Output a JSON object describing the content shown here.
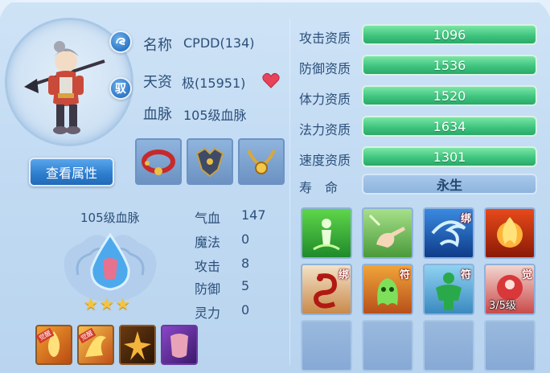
{
  "pet": {
    "name_label": "名称",
    "name_value": "CPDD(134)",
    "talent_label": "天资",
    "talent_value": "极(15951)",
    "blood_label": "血脉",
    "blood_value": "105级血脉",
    "lock_glyph": "驭",
    "view_button": "查看属性"
  },
  "bloodline": {
    "title": "105级血脉",
    "stars": "★★★",
    "stats": [
      {
        "label": "气血",
        "value": "147"
      },
      {
        "label": "魔法",
        "value": "0"
      },
      {
        "label": "攻击",
        "value": "8"
      },
      {
        "label": "防御",
        "value": "5"
      },
      {
        "label": "灵力",
        "value": "0"
      }
    ],
    "small_skill_tag": "觉醒"
  },
  "aptitudes": [
    {
      "label": "攻击资质",
      "value": "1096"
    },
    {
      "label": "防御资质",
      "value": "1536"
    },
    {
      "label": "体力资质",
      "value": "1520"
    },
    {
      "label": "法力资质",
      "value": "1634"
    },
    {
      "label": "速度资质",
      "value": "1301"
    }
  ],
  "lifespan": {
    "label": "寿　命",
    "value": "永生"
  },
  "skills": {
    "badges": {
      "bind": "绑",
      "talisman": "符",
      "awaken": "觉"
    },
    "awaken_level": "3/5级"
  },
  "icons": [
    "dragon-badge-icon",
    "heart-icon",
    "red-collar-icon",
    "armor-icon",
    "gold-necklace-icon"
  ],
  "colors": {
    "accent_green": "#3fc57f",
    "button_blue": "#2f7fd0",
    "background": "#c2dbf3"
  }
}
